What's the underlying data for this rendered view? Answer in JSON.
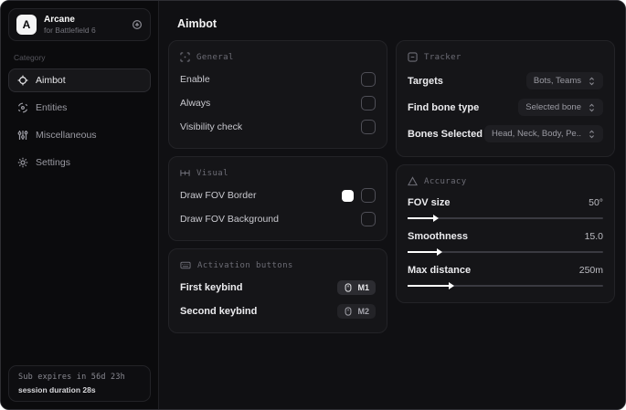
{
  "app": {
    "name": "Arcane",
    "subtitle": "for Battlefield 6",
    "logo_letter": "A"
  },
  "colors": {
    "swatch_fov_border": "#ffffff",
    "accent_text": "#fafafa",
    "panel_bg": "#151518"
  },
  "sidebar": {
    "category_label": "Category",
    "items": [
      {
        "label": "Aimbot",
        "icon": "crosshair-icon",
        "active": true
      },
      {
        "label": "Entities",
        "icon": "entities-icon",
        "active": false
      },
      {
        "label": "Miscellaneous",
        "icon": "sliders-icon",
        "active": false
      },
      {
        "label": "Settings",
        "icon": "gear-icon",
        "active": false
      }
    ],
    "footer": {
      "line1": "Sub expires in 56d 23h",
      "line2": "session duration 28s"
    }
  },
  "main": {
    "title": "Aimbot",
    "panels": {
      "general": {
        "title": "General",
        "rows": [
          {
            "label": "Enable",
            "checked": false
          },
          {
            "label": "Always",
            "checked": false
          },
          {
            "label": "Visibility check",
            "checked": false
          }
        ]
      },
      "visual": {
        "title": "Visual",
        "rows": [
          {
            "label": "Draw FOV Border",
            "swatch": "#ffffff",
            "checked": false
          },
          {
            "label": "Draw FOV Background",
            "checked": false
          }
        ]
      },
      "activation": {
        "title": "Activation buttons",
        "rows": [
          {
            "label": "First keybind",
            "key": "M1"
          },
          {
            "label": "Second keybind",
            "key": "M2"
          }
        ]
      },
      "tracker": {
        "title": "Tracker",
        "rows": [
          {
            "label": "Targets",
            "value": "Bots, Teams"
          },
          {
            "label": "Find bone type",
            "value": "Selected bone"
          },
          {
            "label": "Bones Selected",
            "value": "Head, Neck, Body, Pe.."
          }
        ]
      },
      "accuracy": {
        "title": "Accuracy",
        "rows": [
          {
            "label": "FOV size",
            "value": "50°",
            "percent": 13
          },
          {
            "label": "Smoothness",
            "value": "15.0",
            "percent": 15
          },
          {
            "label": "Max distance",
            "value": "250m",
            "percent": 21
          }
        ]
      }
    }
  }
}
